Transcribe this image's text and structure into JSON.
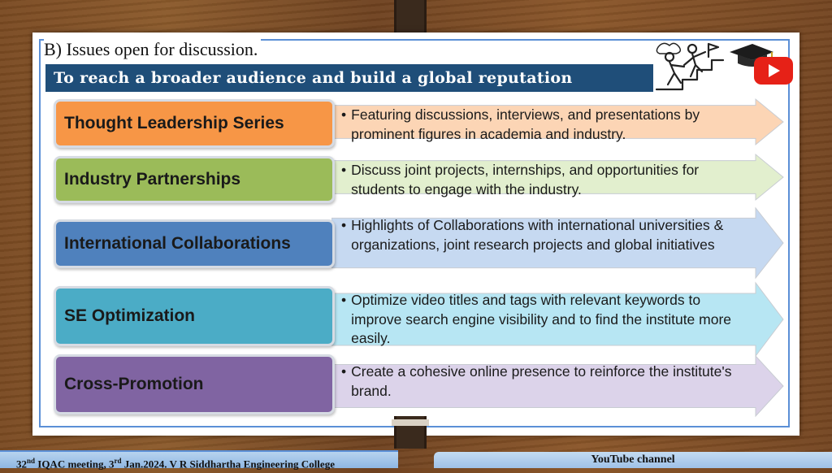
{
  "slide": {
    "section_title": "B) Issues open for discussion.",
    "subtitle": "To reach a broader audience and build a global reputation"
  },
  "colors": {
    "subtitle_bar": "#1f4e79",
    "accent_border": "#5b8fd6"
  },
  "items": [
    {
      "label": "Thought Leadership Series",
      "description": "Featuring discussions, interviews, and presentations by prominent figures in academia and industry.",
      "box_color": "#f79646",
      "arrow_color": "#fcd5b5"
    },
    {
      "label": "Industry Partnerships",
      "description": "Discuss joint projects, internships, and opportunities for students to engage with the industry.",
      "box_color": "#9bbb59",
      "arrow_color": "#e2efce"
    },
    {
      "label": "International Collaborations",
      "description": "Highlights of Collaborations with international universities & organizations, joint research projects and global initiatives",
      "box_color": "#4f81bd",
      "arrow_color": "#c6d9f1"
    },
    {
      "label": "SE Optimization",
      "description": "Optimize video titles and tags with relevant keywords to improve search engine visibility and to find the institute more easily.",
      "box_color": "#4bacc6",
      "arrow_color": "#b7e6f3"
    },
    {
      "label": "Cross-Promotion",
      "description": "Create a cohesive online presence to reinforce the institute's brand.",
      "box_color": "#8064a2",
      "arrow_color": "#dcd3ea"
    }
  ],
  "footer": {
    "n1": "32",
    "sup1": "nd",
    "mid": " IQAC meeting, 3",
    "sup2": "rd",
    "rest": " Jan.2024. V R Siddhartha Engineering College",
    "right": "YouTube channel"
  },
  "icons": [
    "climbing-figures-icon",
    "graduation-cap-icon",
    "youtube-logo-icon"
  ]
}
